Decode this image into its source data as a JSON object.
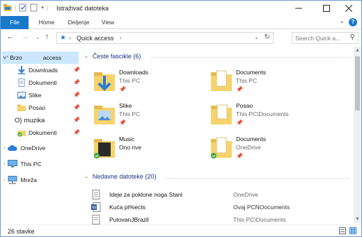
{
  "window": {
    "title": "Istraživač datoteka"
  },
  "ribbon": {
    "tabs": [
      "File",
      "Home",
      "Deljenje",
      "View"
    ]
  },
  "address": {
    "path": "Quick access",
    "search_placeholder": "Search Quick a..."
  },
  "nav": {
    "quick_access": {
      "label_a": "Brzo",
      "label_b": "access"
    },
    "pinned": [
      {
        "label": "Downloads",
        "icon": "download-arrow-icon"
      },
      {
        "label": "Dokumenti",
        "icon": "document-icon"
      },
      {
        "label": "Slike",
        "icon": "pictures-icon"
      },
      {
        "label": "Posao",
        "icon": "folder-icon"
      },
      {
        "label": "O} muzika",
        "icon": "music-icon"
      },
      {
        "label": "Dokumenti",
        "icon": "folder-check-icon"
      }
    ],
    "roots": [
      {
        "label": "OneDrive",
        "icon": "cloud-icon"
      },
      {
        "label": "This PC",
        "icon": "computer-icon"
      },
      {
        "label": "Mreža",
        "icon": "network-icon"
      }
    ]
  },
  "groups": {
    "frequent": {
      "title": "Česte fascikle (6)"
    },
    "recent": {
      "title": "Nedavne datoteke (20)"
    }
  },
  "frequent": [
    {
      "name": "Downloads",
      "location": "This PC",
      "icon": "download-folder-icon"
    },
    {
      "name": "Documents",
      "location": "This PC",
      "icon": "documents-folder-icon"
    },
    {
      "name": "Slike",
      "location": "This PC",
      "icon": "pictures-folder-icon"
    },
    {
      "name": "Posao",
      "location": "This PC\\Documents",
      "icon": "folder-icon"
    },
    {
      "name": "Music",
      "location": "Ono rive",
      "icon": "music-folder-icon"
    },
    {
      "name": "Documents",
      "location": "OneDrive",
      "icon": "onedrive-folder-icon"
    }
  ],
  "recent": [
    {
      "name": "Ideje za poklone noga Stanl",
      "location": "OneDrive",
      "icon": "text-file-icon"
    },
    {
      "name": "Kuća pt%ects",
      "location": "Ovaj PCNOocuments",
      "icon": "word-file-icon"
    },
    {
      "name": "PutovanJBrazil",
      "location": "This PC\\Documents",
      "icon": "text-file-icon"
    }
  ],
  "status": {
    "text": "26 stavke"
  },
  "colors": {
    "accent": "#1979ca",
    "folder": "#f6d36b",
    "selection": "#cce8ff",
    "group_header": "#1e3287"
  }
}
